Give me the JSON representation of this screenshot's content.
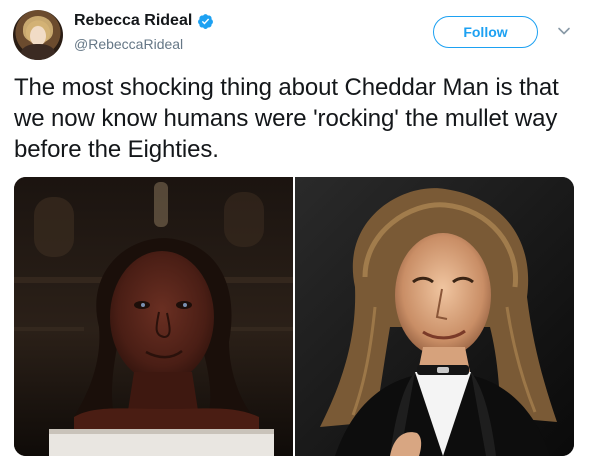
{
  "tweet": {
    "author": {
      "display_name": "Rebecca Rideal",
      "handle": "@RebeccaRideal",
      "verified": true,
      "avatar_icon": "profile-avatar"
    },
    "follow_label": "Follow",
    "menu_icon": "chevron-down-icon",
    "text": "The most shocking thing about Cheddar Man is that we now know humans were 'rocking' the mullet way before the Eighties.",
    "media": [
      {
        "icon": "cheddar-man-reconstruction-photo"
      },
      {
        "icon": "mullet-musician-photo"
      }
    ]
  },
  "colors": {
    "accent": "#1da1f2",
    "text": "#14171a",
    "secondary_text": "#657786"
  }
}
